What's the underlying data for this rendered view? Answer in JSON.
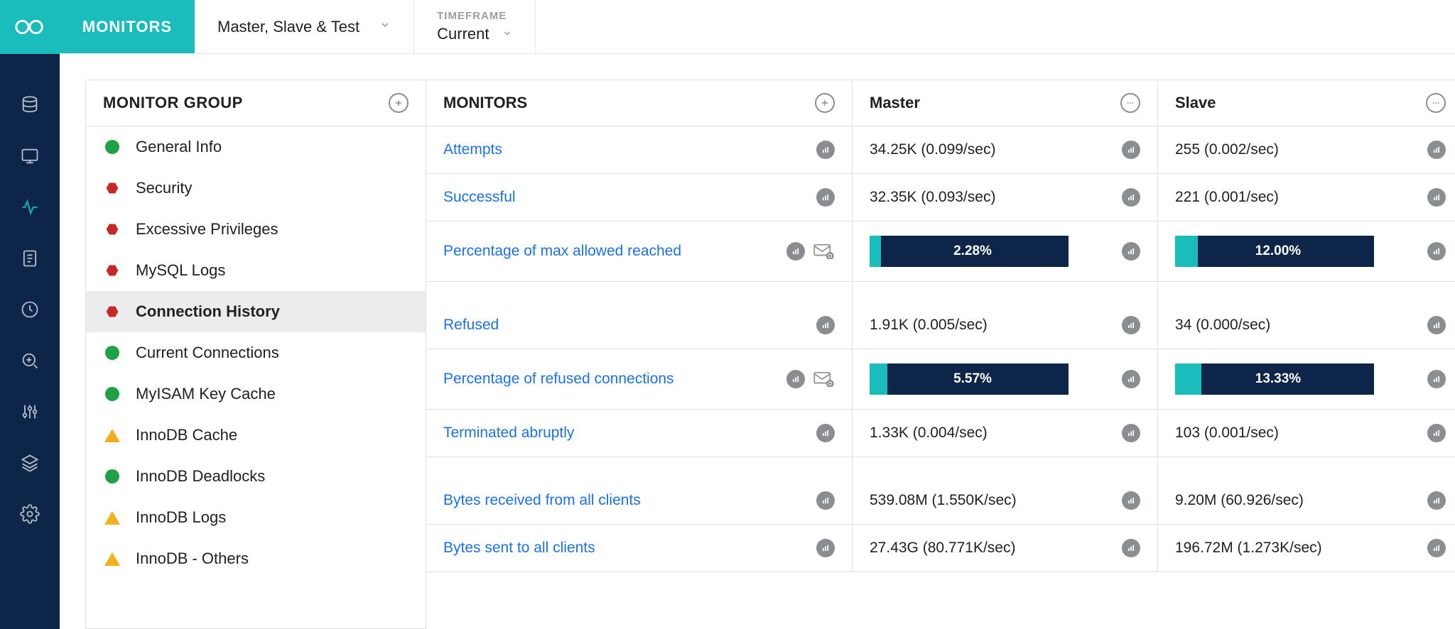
{
  "header": {
    "monitors_label": "MONITORS",
    "server_selector": "Master, Slave & Test",
    "timeframe_caption": "TIMEFRAME",
    "timeframe_value": "Current"
  },
  "sidebar": {
    "title": "MONITOR GROUP",
    "items": [
      {
        "label": "General Info",
        "status": "green"
      },
      {
        "label": "Security",
        "status": "red"
      },
      {
        "label": "Excessive Privileges",
        "status": "red"
      },
      {
        "label": "MySQL Logs",
        "status": "red"
      },
      {
        "label": "Connection History",
        "status": "red",
        "selected": true
      },
      {
        "label": "Current Connections",
        "status": "green"
      },
      {
        "label": "MyISAM Key Cache",
        "status": "green"
      },
      {
        "label": "InnoDB Cache",
        "status": "yellow"
      },
      {
        "label": "InnoDB Deadlocks",
        "status": "green"
      },
      {
        "label": "InnoDB Logs",
        "status": "yellow"
      },
      {
        "label": "InnoDB - Others",
        "status": "yellow"
      }
    ]
  },
  "table": {
    "columns": {
      "monitors": "MONITORS",
      "c1": "Master",
      "c2": "Slave"
    },
    "rows": [
      {
        "name": "Attempts",
        "master": "34.25K (0.099/sec)",
        "slave": "255 (0.002/sec)"
      },
      {
        "name": "Successful",
        "master": "32.35K (0.093/sec)",
        "slave": "221 (0.001/sec)"
      },
      {
        "name": "Percentage of max allowed reached",
        "type": "progress",
        "mail": true,
        "master": "2.28%",
        "master_fill": 2.28,
        "slave": "12.00%",
        "slave_fill": 8
      },
      {
        "type": "gap"
      },
      {
        "name": "Refused",
        "master": "1.91K (0.005/sec)",
        "slave": "34 (0.000/sec)"
      },
      {
        "name": "Percentage of refused connections",
        "type": "progress",
        "mail": true,
        "master": "5.57%",
        "master_fill": 5.57,
        "slave": "13.33%",
        "slave_fill": 10
      },
      {
        "name": "Terminated abruptly",
        "master": "1.33K (0.004/sec)",
        "slave": "103 (0.001/sec)"
      },
      {
        "type": "gap"
      },
      {
        "name": "Bytes received from all clients",
        "master": "539.08M (1.550K/sec)",
        "slave": "9.20M (60.926/sec)"
      },
      {
        "name": "Bytes sent to all clients",
        "master": "27.43G (80.771K/sec)",
        "slave": "196.72M (1.273K/sec)"
      }
    ]
  }
}
